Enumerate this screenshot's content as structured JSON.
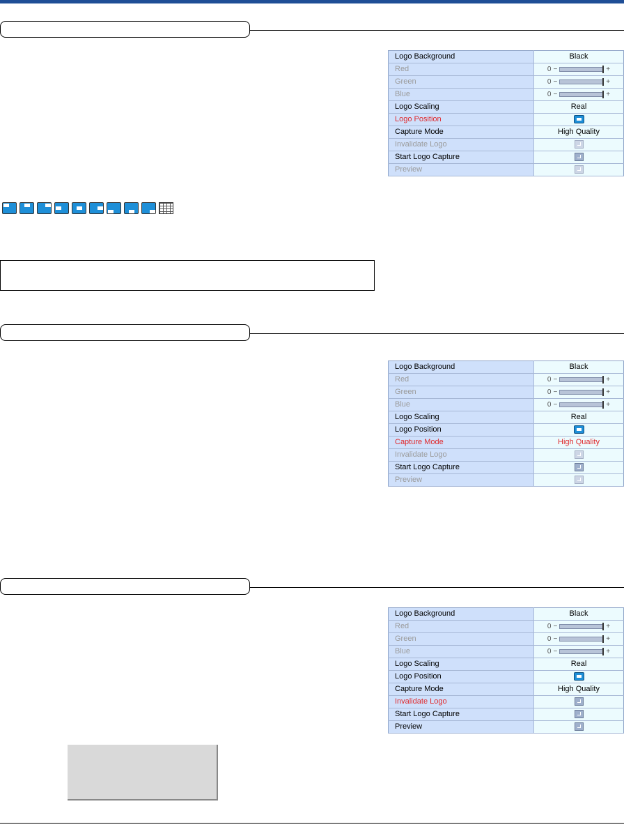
{
  "menus": [
    {
      "rows": [
        {
          "label": "Logo Background",
          "type": "text",
          "value": "Black",
          "state": "normal"
        },
        {
          "label": "Red",
          "type": "slider",
          "value": "0",
          "minus": "−",
          "plus": "+",
          "state": "dim"
        },
        {
          "label": "Green",
          "type": "slider",
          "value": "0",
          "minus": "−",
          "plus": "+",
          "state": "dim"
        },
        {
          "label": "Blue",
          "type": "slider",
          "value": "0",
          "minus": "−",
          "plus": "+",
          "state": "dim"
        },
        {
          "label": "Logo Scaling",
          "type": "text",
          "value": "Real",
          "state": "normal"
        },
        {
          "label": "Logo Position",
          "type": "position-icon",
          "value": "",
          "state": "active"
        },
        {
          "label": "Capture Mode",
          "type": "text",
          "value": "High Quality",
          "state": "normal"
        },
        {
          "label": "Invalidate Logo",
          "type": "enter-icon",
          "value": "",
          "state": "dim"
        },
        {
          "label": "Start Logo Capture",
          "type": "enter-icon",
          "value": "",
          "state": "normal"
        },
        {
          "label": "Preview",
          "type": "enter-icon",
          "value": "",
          "state": "dim"
        }
      ]
    },
    {
      "rows": [
        {
          "label": "Logo Background",
          "type": "text",
          "value": "Black",
          "state": "normal"
        },
        {
          "label": "Red",
          "type": "slider",
          "value": "0",
          "minus": "−",
          "plus": "+",
          "state": "dim"
        },
        {
          "label": "Green",
          "type": "slider",
          "value": "0",
          "minus": "−",
          "plus": "+",
          "state": "dim"
        },
        {
          "label": "Blue",
          "type": "slider",
          "value": "0",
          "minus": "−",
          "plus": "+",
          "state": "dim"
        },
        {
          "label": "Logo Scaling",
          "type": "text",
          "value": "Real",
          "state": "normal"
        },
        {
          "label": "Logo Position",
          "type": "position-icon",
          "value": "",
          "state": "normal"
        },
        {
          "label": "Capture Mode",
          "type": "text",
          "value": "High Quality",
          "state": "active"
        },
        {
          "label": "Invalidate Logo",
          "type": "enter-icon",
          "value": "",
          "state": "dim"
        },
        {
          "label": "Start Logo Capture",
          "type": "enter-icon",
          "value": "",
          "state": "normal"
        },
        {
          "label": "Preview",
          "type": "enter-icon",
          "value": "",
          "state": "dim"
        }
      ]
    },
    {
      "rows": [
        {
          "label": "Logo Background",
          "type": "text",
          "value": "Black",
          "state": "normal"
        },
        {
          "label": "Red",
          "type": "slider",
          "value": "0",
          "minus": "−",
          "plus": "+",
          "state": "dim"
        },
        {
          "label": "Green",
          "type": "slider",
          "value": "0",
          "minus": "−",
          "plus": "+",
          "state": "dim"
        },
        {
          "label": "Blue",
          "type": "slider",
          "value": "0",
          "minus": "−",
          "plus": "+",
          "state": "dim"
        },
        {
          "label": "Logo Scaling",
          "type": "text",
          "value": "Real",
          "state": "normal"
        },
        {
          "label": "Logo Position",
          "type": "position-icon",
          "value": "",
          "state": "normal"
        },
        {
          "label": "Capture Mode",
          "type": "text",
          "value": "High Quality",
          "state": "normal"
        },
        {
          "label": "Invalidate Logo",
          "type": "enter-icon",
          "value": "",
          "state": "active"
        },
        {
          "label": "Start Logo Capture",
          "type": "enter-icon",
          "value": "",
          "state": "normal"
        },
        {
          "label": "Preview",
          "type": "enter-icon",
          "value": "",
          "state": "normal"
        }
      ]
    }
  ],
  "position_options": [
    "top-left",
    "top-center",
    "top-right",
    "middle-left",
    "center",
    "middle-right",
    "bottom-left",
    "bottom-center",
    "bottom-right",
    "grid"
  ],
  "colors": {
    "header_bar": "#1f4e96",
    "label_bg": "#cfe0fb",
    "value_bg": "#ecfbfe",
    "active_text": "#e0292c",
    "dim_text": "#9a9a9a",
    "position_icon": "#1e8fd8"
  }
}
